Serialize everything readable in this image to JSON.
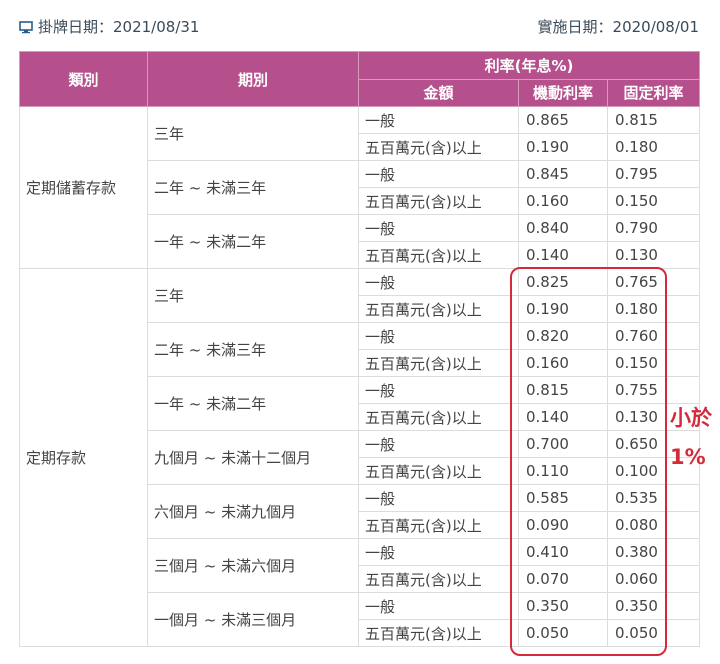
{
  "header": {
    "post_date_label": "掛牌日期：2021/08/31",
    "effective_date_label": "實施日期：2020/08/01",
    "icon": "monitor-icon"
  },
  "table": {
    "headers": {
      "category": "類別",
      "term": "期別",
      "rate_group": "利率(年息%)",
      "amount": "金額",
      "floating": "機動利率",
      "fixed": "固定利率"
    },
    "sections": [
      {
        "category": "定期儲蓄存款",
        "terms": [
          {
            "term": "三年",
            "rows": [
              {
                "amount": "一般",
                "floating": "0.865",
                "fixed": "0.815"
              },
              {
                "amount": "五百萬元(含)以上",
                "floating": "0.190",
                "fixed": "0.180"
              }
            ]
          },
          {
            "term": "二年 ~ 未滿三年",
            "rows": [
              {
                "amount": "一般",
                "floating": "0.845",
                "fixed": "0.795"
              },
              {
                "amount": "五百萬元(含)以上",
                "floating": "0.160",
                "fixed": "0.150"
              }
            ]
          },
          {
            "term": "一年 ~ 未滿二年",
            "rows": [
              {
                "amount": "一般",
                "floating": "0.840",
                "fixed": "0.790"
              },
              {
                "amount": "五百萬元(含)以上",
                "floating": "0.140",
                "fixed": "0.130"
              }
            ]
          }
        ]
      },
      {
        "category": "定期存款",
        "terms": [
          {
            "term": "三年",
            "rows": [
              {
                "amount": "一般",
                "floating": "0.825",
                "fixed": "0.765"
              },
              {
                "amount": "五百萬元(含)以上",
                "floating": "0.190",
                "fixed": "0.180"
              }
            ]
          },
          {
            "term": "二年 ~ 未滿三年",
            "rows": [
              {
                "amount": "一般",
                "floating": "0.820",
                "fixed": "0.760"
              },
              {
                "amount": "五百萬元(含)以上",
                "floating": "0.160",
                "fixed": "0.150"
              }
            ]
          },
          {
            "term": "一年 ~ 未滿二年",
            "rows": [
              {
                "amount": "一般",
                "floating": "0.815",
                "fixed": "0.755"
              },
              {
                "amount": "五百萬元(含)以上",
                "floating": "0.140",
                "fixed": "0.130"
              }
            ]
          },
          {
            "term": "九個月 ~ 未滿十二個月",
            "rows": [
              {
                "amount": "一般",
                "floating": "0.700",
                "fixed": "0.650"
              },
              {
                "amount": "五百萬元(含)以上",
                "floating": "0.110",
                "fixed": "0.100"
              }
            ]
          },
          {
            "term": "六個月 ~ 未滿九個月",
            "rows": [
              {
                "amount": "一般",
                "floating": "0.585",
                "fixed": "0.535"
              },
              {
                "amount": "五百萬元(含)以上",
                "floating": "0.090",
                "fixed": "0.080"
              }
            ]
          },
          {
            "term": "三個月 ~ 未滿六個月",
            "rows": [
              {
                "amount": "一般",
                "floating": "0.410",
                "fixed": "0.380"
              },
              {
                "amount": "五百萬元(含)以上",
                "floating": "0.070",
                "fixed": "0.060"
              }
            ]
          },
          {
            "term": "一個月 ~ 未滿三個月",
            "rows": [
              {
                "amount": "一般",
                "floating": "0.350",
                "fixed": "0.350"
              },
              {
                "amount": "五百萬元(含)以上",
                "floating": "0.050",
                "fixed": "0.050"
              }
            ]
          }
        ]
      }
    ]
  },
  "annotation": {
    "line1": "小於",
    "line2": "1%",
    "color": "#d42a3a"
  },
  "colors": {
    "header_bg": "#b5508d",
    "header_text": "#ffffff"
  }
}
